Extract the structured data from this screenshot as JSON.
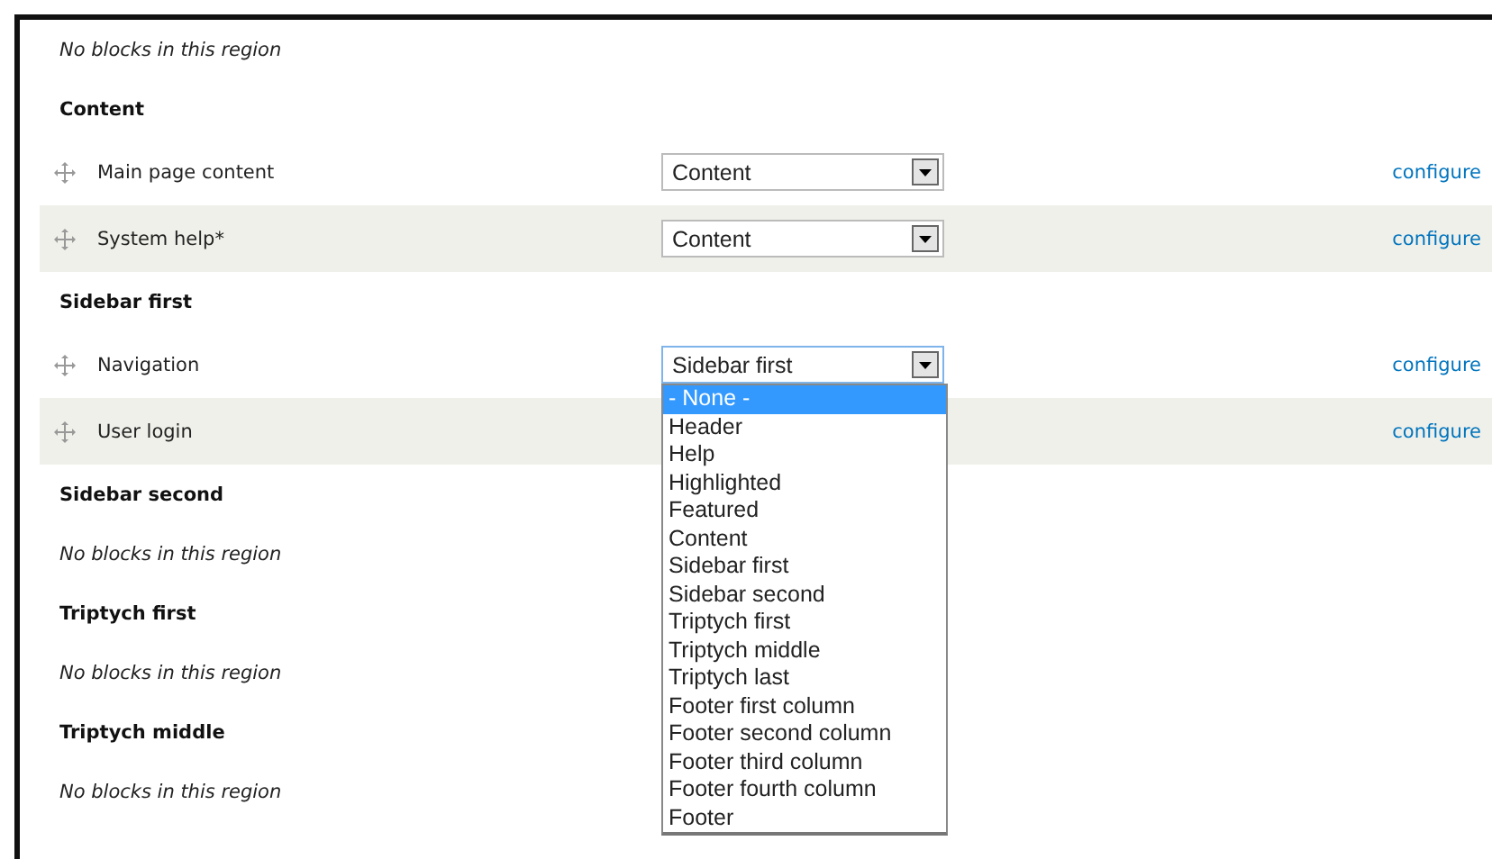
{
  "regions": [
    {
      "empty_text": "No blocks in this region"
    },
    {
      "title": "Content",
      "blocks": [
        {
          "name": "Main page content",
          "region": "Content",
          "link": "configure",
          "expanded": false
        },
        {
          "name": "System help*",
          "region": "Content",
          "link": "configure",
          "expanded": false
        }
      ]
    },
    {
      "title": "Sidebar first",
      "blocks": [
        {
          "name": "Navigation",
          "region": "Sidebar first",
          "link": "configure",
          "expanded": true,
          "options": [
            {
              "label": "- None -",
              "selected": true
            },
            {
              "label": "Header",
              "selected": false
            },
            {
              "label": "Help",
              "selected": false
            },
            {
              "label": "Highlighted",
              "selected": false
            },
            {
              "label": "Featured",
              "selected": false
            },
            {
              "label": "Content",
              "selected": false
            },
            {
              "label": "Sidebar first",
              "selected": false
            },
            {
              "label": "Sidebar second",
              "selected": false
            },
            {
              "label": "Triptych first",
              "selected": false
            },
            {
              "label": "Triptych middle",
              "selected": false
            },
            {
              "label": "Triptych last",
              "selected": false
            },
            {
              "label": "Footer first column",
              "selected": false
            },
            {
              "label": "Footer second column",
              "selected": false
            },
            {
              "label": "Footer third column",
              "selected": false
            },
            {
              "label": "Footer fourth column",
              "selected": false
            },
            {
              "label": "Footer",
              "selected": false
            }
          ]
        },
        {
          "name": "User login",
          "link": "configure"
        }
      ]
    },
    {
      "title": "Sidebar second",
      "empty_text": "No blocks in this region"
    },
    {
      "title": "Triptych first",
      "empty_text": "No blocks in this region"
    },
    {
      "title": "Triptych middle",
      "empty_text": "No blocks in this region"
    }
  ]
}
